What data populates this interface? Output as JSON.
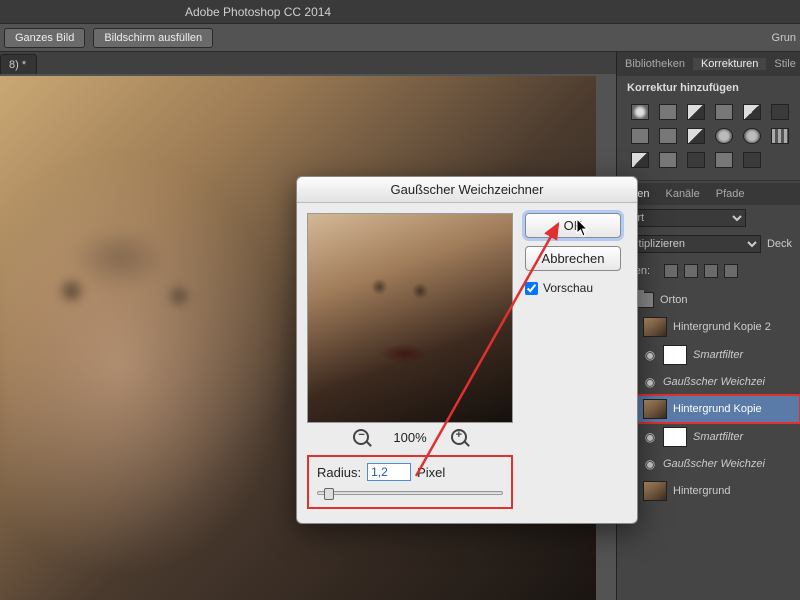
{
  "app": {
    "title": "Adobe Photoshop CC 2014"
  },
  "options": {
    "btn1": "Ganzes Bild",
    "btn2": "Bildschirm ausfüllen",
    "right": "Grun"
  },
  "doctab": "8) *",
  "panels": {
    "tabs": [
      "Bibliotheken",
      "Korrekturen",
      "Stile"
    ],
    "activeTab": 1,
    "subhead": "Korrektur hinzufügen"
  },
  "layerPanel": {
    "tabs": [
      "enen",
      "Kanäle",
      "Pfade"
    ],
    "kind": "Art",
    "blend": "ultiplizieren",
    "opacityLabel": "Deck",
    "lockLabel": "eren:"
  },
  "layers": {
    "group": "Orton",
    "l1": "Hintergrund Kopie 2",
    "smart": "Smartfilter",
    "gauss": "Gaußscher Weichzei",
    "l2": "Hintergrund Kopie",
    "bg": "Hintergrund"
  },
  "dialog": {
    "title": "Gaußscher Weichzeichner",
    "ok": "OK",
    "cancel": "Abbrechen",
    "preview": "Vorschau",
    "zoom": "100%",
    "radiusLabel": "Radius:",
    "radiusValue": "1,2",
    "radiusUnit": "Pixel"
  }
}
